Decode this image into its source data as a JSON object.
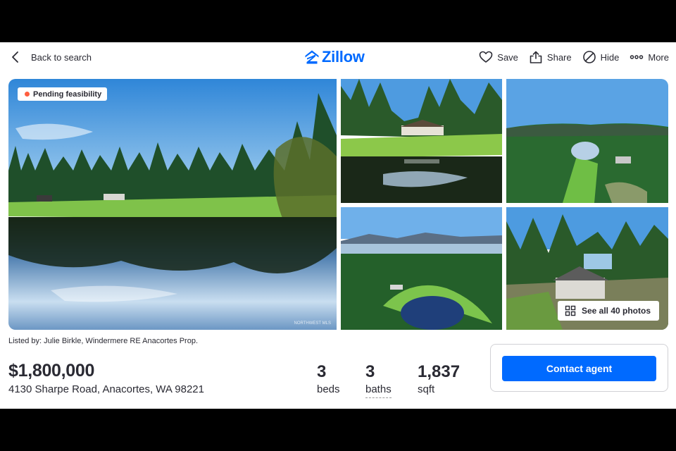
{
  "header": {
    "back_label": "Back to search",
    "logo_text": "Zillow",
    "actions": [
      {
        "label": "Save",
        "icon": "heart-icon"
      },
      {
        "label": "Share",
        "icon": "share-icon"
      },
      {
        "label": "Hide",
        "icon": "hide-icon"
      },
      {
        "label": "More",
        "icon": "more-icon"
      }
    ]
  },
  "gallery": {
    "status_badge": "Pending feasibility",
    "see_all_label": "See all 40 photos",
    "watermark": "NORTHWEST MLS"
  },
  "listing": {
    "listed_by": "Listed by: Julie Birkle, Windermere RE Anacortes Prop.",
    "price": "$1,800,000",
    "address": "4130 Sharpe Road, Anacortes, WA 98221",
    "beds_value": "3",
    "beds_label": "beds",
    "baths_value": "3",
    "baths_label": "baths",
    "sqft_value": "1,837",
    "sqft_label": "sqft"
  },
  "contact": {
    "button_label": "Contact agent"
  },
  "colors": {
    "brand": "#006aff",
    "text": "#2a2a33",
    "status_dot": "#ff5e3f",
    "frame_bg": "#000000"
  }
}
